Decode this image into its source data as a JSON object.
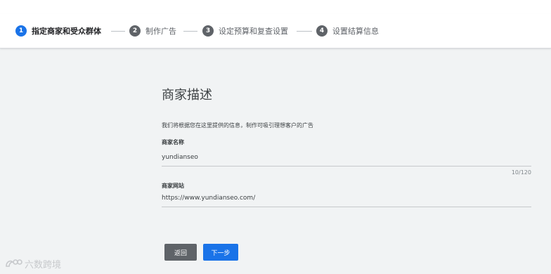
{
  "stepper": {
    "steps": [
      {
        "number": "1",
        "label": "指定商家和受众群体",
        "active": true
      },
      {
        "number": "2",
        "label": "制作广告",
        "active": false
      },
      {
        "number": "3",
        "label": "设定预算和复查设置",
        "active": false
      },
      {
        "number": "4",
        "label": "设置结算信息",
        "active": false
      }
    ]
  },
  "form": {
    "title": "商家描述",
    "description": "我们将根据您在这里提供的信息，制作可吸引理想客户的广告",
    "business_name_label": "商家名称",
    "business_name_value": "yundianseo",
    "business_name_counter": "10/120",
    "website_label": "商家网站",
    "website_value": "https://www.yundianseo.com/"
  },
  "buttons": {
    "back": "返回",
    "next": "下一步"
  },
  "watermark": {
    "text": "六数跨境"
  },
  "colors": {
    "accent": "#1a73e8",
    "inactive_step": "#5f6368",
    "background": "#f1f3f4"
  }
}
